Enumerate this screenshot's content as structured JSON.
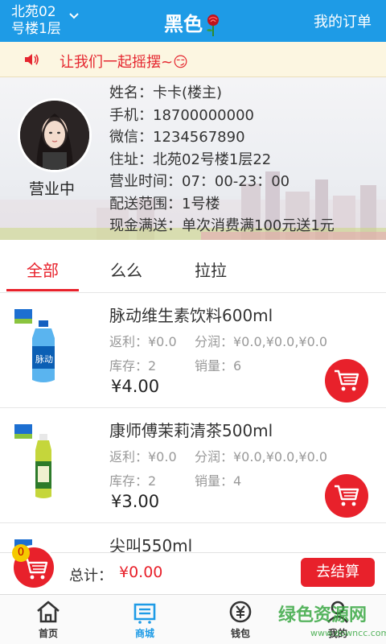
{
  "topbar": {
    "location_line1": "北苑02",
    "location_line2": "号楼1层",
    "title": "黑色",
    "my_orders": "我的订单"
  },
  "notice": {
    "text": "让我们一起摇摆~😏"
  },
  "shop": {
    "status": "营业中",
    "info": [
      "姓名：卡卡(楼主)",
      "手机：18700000000",
      "微信：1234567890",
      "住址：北苑02号楼1层22",
      "营业时间：07：00-23：00",
      "配送范围：1号楼",
      "现金满送：单次消费满100元送1元"
    ]
  },
  "tabs": [
    "全部",
    "么么",
    "拉拉"
  ],
  "products": [
    {
      "name": "脉动维生素饮料600ml",
      "rebate": "返利：¥0.0",
      "share": "分润：¥0.0,¥0.0,¥0.0",
      "stock": "库存：2",
      "sales": "销量：6",
      "price": "¥4.00"
    },
    {
      "name": "康师傅茉莉清茶500ml",
      "rebate": "返利：¥0.0",
      "share": "分润：¥0.0,¥0.0,¥0.0",
      "stock": "库存：2",
      "sales": "销量：4",
      "price": "¥3.00"
    },
    {
      "name": "尖叫550ml"
    }
  ],
  "footer": {
    "cart_count": "0",
    "total_label": "总计：",
    "total_value": "¥0.00",
    "checkout": "去结算"
  },
  "nav": [
    {
      "label": "首页",
      "icon": "home-icon"
    },
    {
      "label": "商城",
      "icon": "store-icon"
    },
    {
      "label": "钱包",
      "icon": "wallet-icon"
    },
    {
      "label": "我的",
      "icon": "profile-icon"
    }
  ],
  "watermark": {
    "text": "绿色资源网",
    "url": "www.downcc.com"
  },
  "colors": {
    "primary": "#1e9be6",
    "accent": "#e8212b",
    "notice_bg": "#fcf6e1"
  }
}
